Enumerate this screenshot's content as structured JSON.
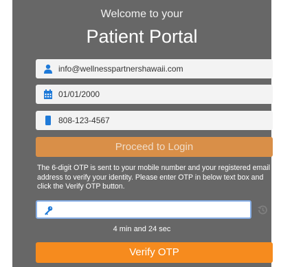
{
  "header": {
    "welcome": "Welcome to your",
    "portal_title": "Patient Portal"
  },
  "fields": {
    "email": {
      "value": "info@wellnesspartnershawaii.com",
      "icon": "user-icon"
    },
    "dob": {
      "value": "01/01/2000",
      "icon": "calendar-icon"
    },
    "phone": {
      "value": "808-123-4567",
      "icon": "phone-icon"
    }
  },
  "buttons": {
    "proceed": "Proceed to Login",
    "verify": "Verify OTP"
  },
  "otp": {
    "instructions": "The 6-digit OTP is sent to your mobile number and your registered email address to verify your identity. Please enter OTP in below text box and click the Verify OTP button.",
    "value": "",
    "icon": "key-icon",
    "resend_icon": "history-icon",
    "timer": "4 min and 24 sec"
  },
  "colors": {
    "panel": "#676767",
    "accent": "#1f7ad8",
    "proceed_disabled": "#d98f48",
    "verify": "#f68b1e",
    "focus_border": "#86aee6"
  }
}
